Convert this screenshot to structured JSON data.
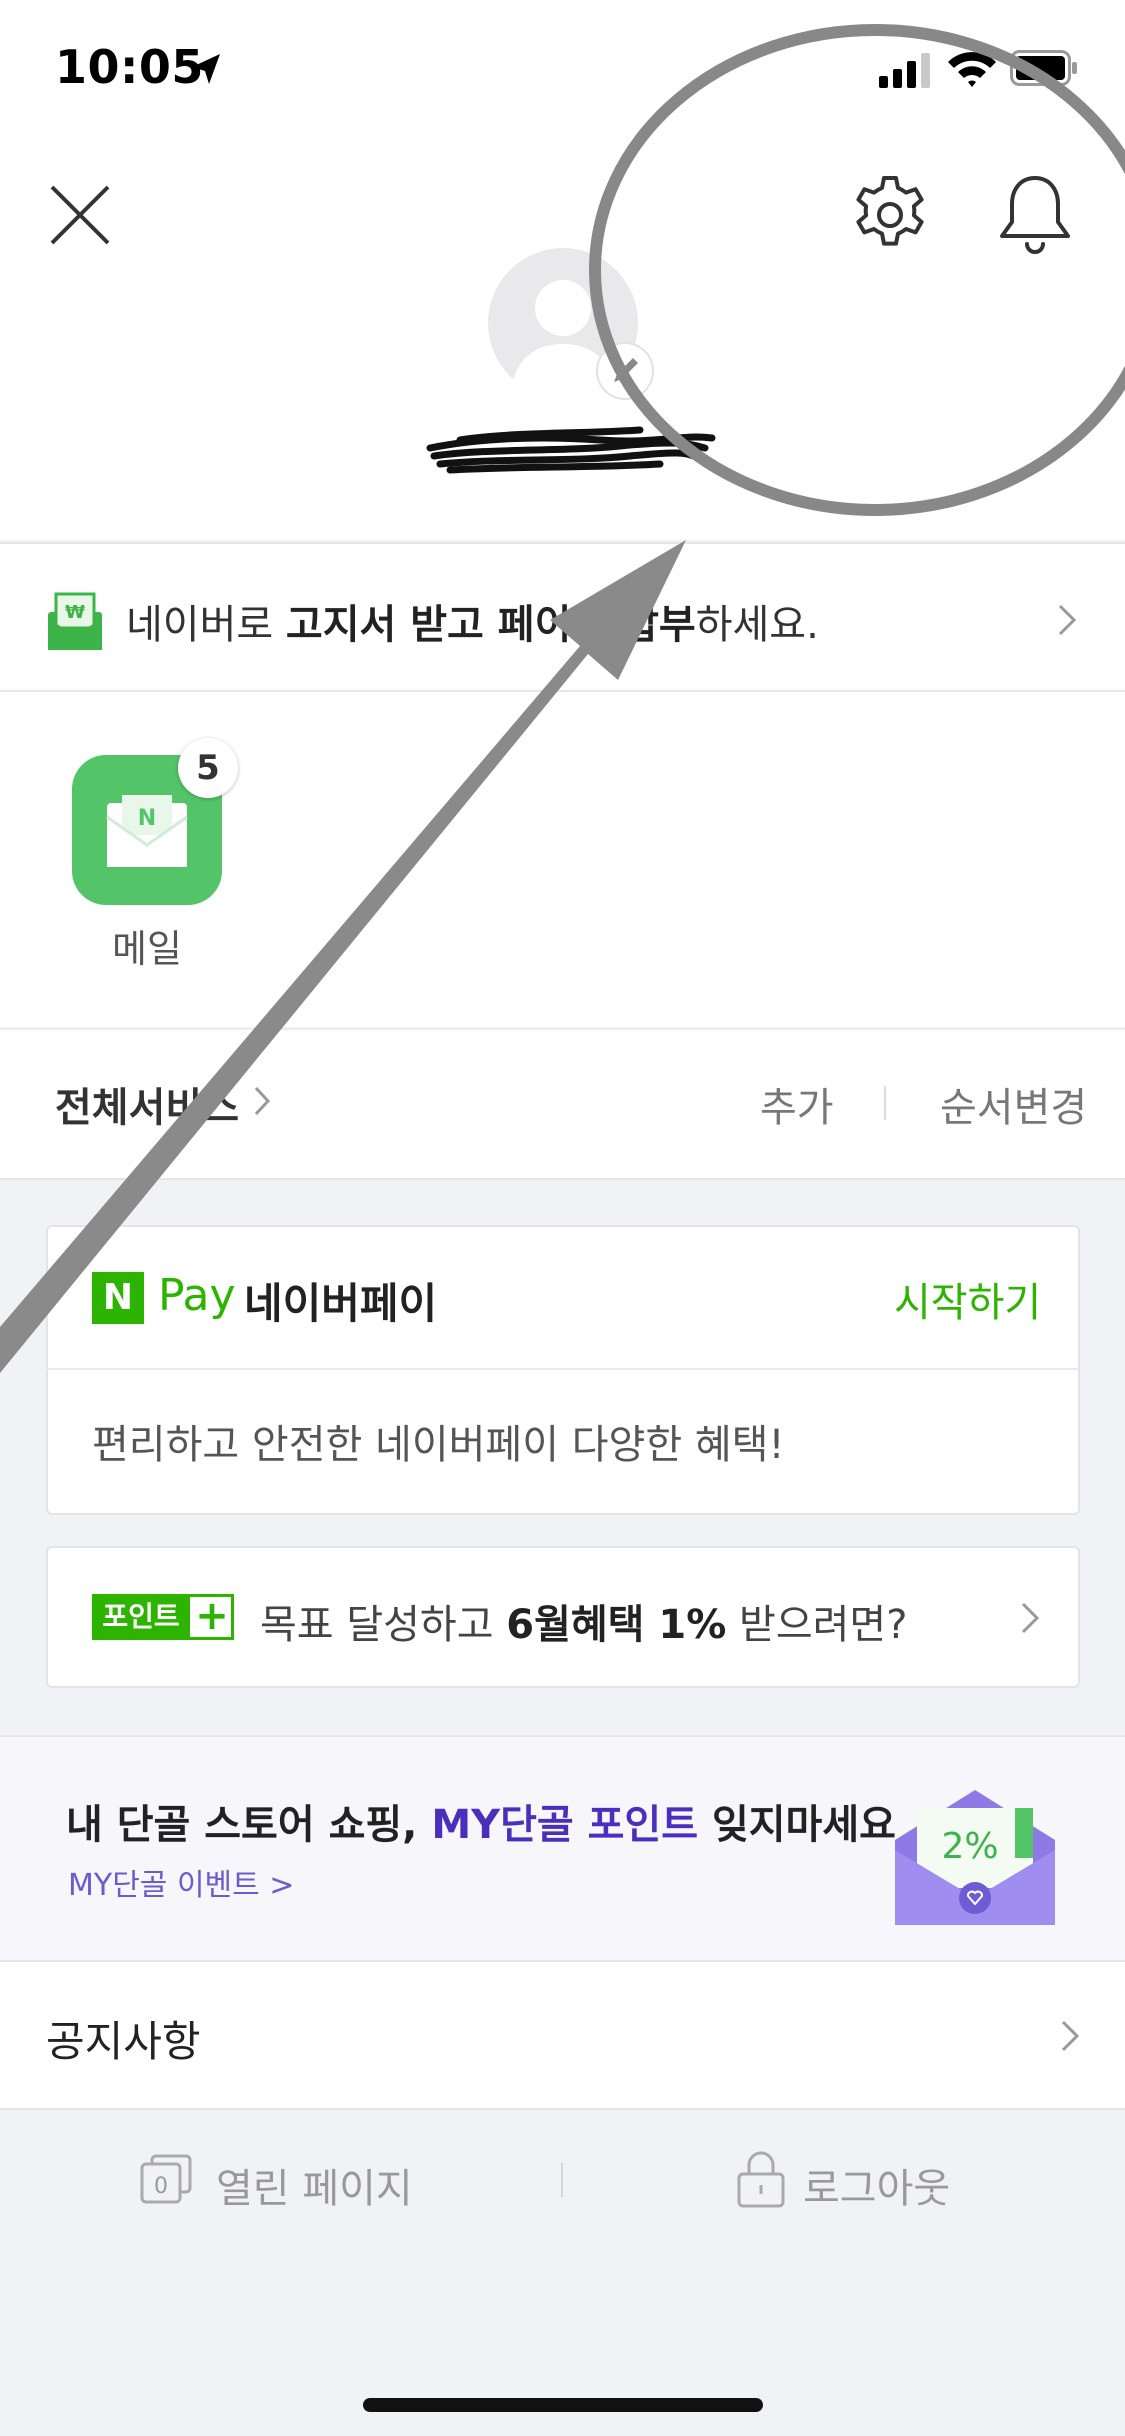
{
  "status_bar": {
    "time": "10:05",
    "location_icon": "location-arrow-icon",
    "signal_icon": "cellular-signal-icon",
    "wifi_icon": "wifi-icon",
    "battery_icon": "battery-icon"
  },
  "header": {
    "close_icon": "close-icon",
    "settings_icon": "gear-icon",
    "notifications_icon": "bell-icon",
    "avatar_icon": "default-avatar-icon",
    "avatar_edit_icon": "pencil-icon"
  },
  "bill_banner": {
    "icon": "won-bill-envelope-icon",
    "text_pre": "네이버로 ",
    "text_bold": "고지서 받고 페이로 납부",
    "text_post": "하세요."
  },
  "apps": [
    {
      "label": "메일",
      "badge": "5",
      "icon": "mail-n-icon",
      "color": "#54c468"
    }
  ],
  "service_row": {
    "all_services": "전체서비스",
    "add": "추가",
    "reorder": "순서변경"
  },
  "pay_card": {
    "logo": "N",
    "pay_label": "Pay",
    "title": "네이버페이",
    "start": "시작하기",
    "description": "편리하고 안전한 네이버페이 다양한 혜택!"
  },
  "point_card": {
    "badge_text": "포인트",
    "badge_plus": "+",
    "text_pre": "목표 달성하고 ",
    "text_bold": "6월혜택 1%",
    "text_post": " 받으려면?"
  },
  "danggol_banner": {
    "title_pre": "내 단골 스토어 쇼핑, ",
    "title_accent": "MY단골 포인트",
    "title_post": " 잊지마세요",
    "subtitle": "MY단골 이벤트 >",
    "envelope_percent": "2%"
  },
  "notice": {
    "label": "공지사항"
  },
  "footer": {
    "open_pages_count": "0",
    "open_pages": "열린 페이지",
    "logout": "로그아웃"
  },
  "colors": {
    "naver_green": "#2db400",
    "app_green": "#54c468",
    "purple_accent": "#4a2fbd",
    "background": "#f1f2f6"
  }
}
